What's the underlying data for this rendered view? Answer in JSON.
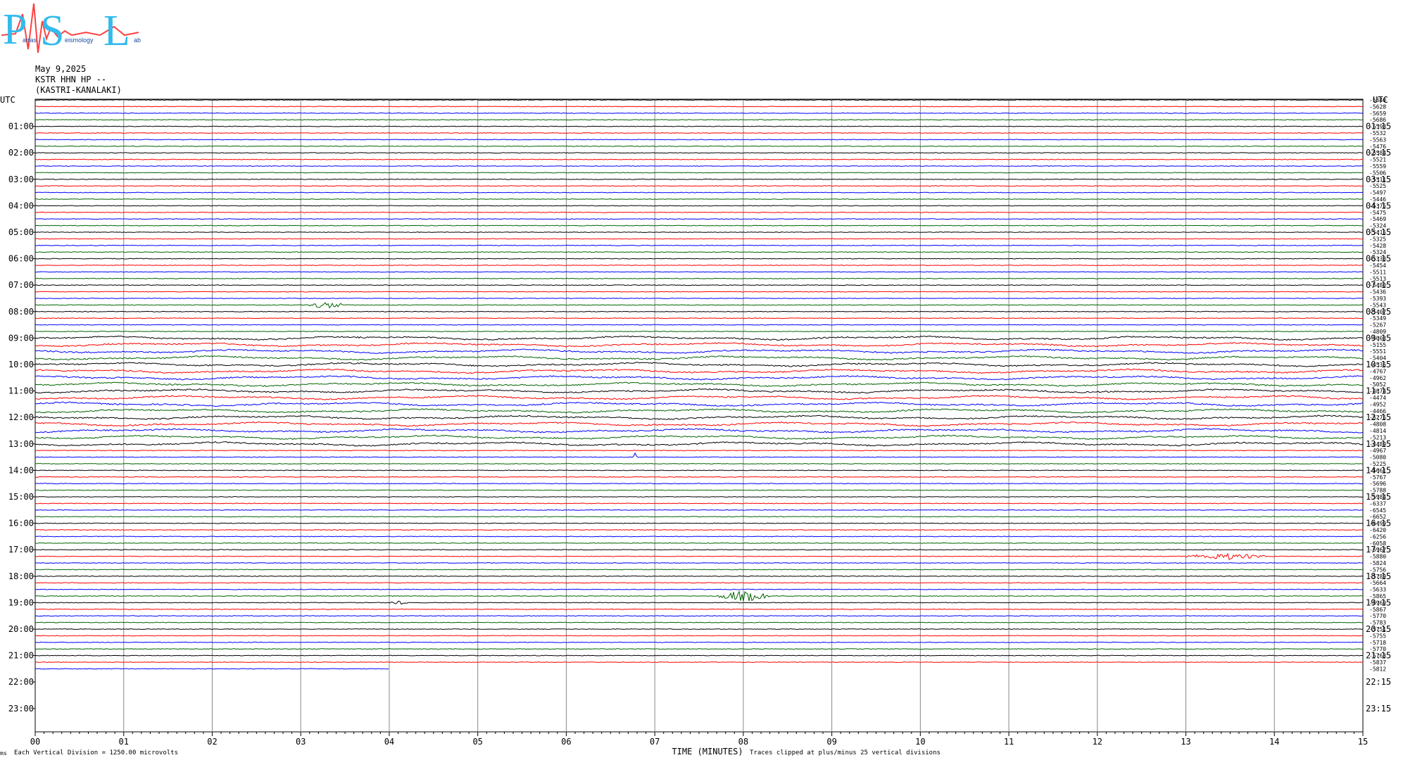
{
  "logo": {
    "big_letters": [
      "P",
      "S",
      "L"
    ],
    "small_text": [
      "atras",
      "eismology",
      "ab"
    ]
  },
  "header": {
    "date": "May 9,2025",
    "station": "KSTR HHN HP --",
    "site": "(KASTRI-KANALAKI)"
  },
  "chart_data": {
    "type": "line",
    "subtype": "helicorder",
    "xlabel": "TIME (MINUTES)",
    "x_ticks": [
      "00",
      "01",
      "02",
      "03",
      "04",
      "05",
      "06",
      "07",
      "08",
      "09",
      "10",
      "11",
      "12",
      "13",
      "14",
      "15"
    ],
    "xlim": [
      0,
      15
    ],
    "left_axis_title": "UTC",
    "right_axis_title": "UTC",
    "left_labels": [
      "01:00",
      "02:00",
      "03:00",
      "04:00",
      "05:00",
      "06:00",
      "07:00",
      "08:00",
      "09:00",
      "10:00",
      "11:00",
      "12:00",
      "13:00",
      "14:00",
      "15:00",
      "16:00",
      "17:00",
      "18:00",
      "19:00",
      "20:00",
      "21:00",
      "22:00",
      "23:00"
    ],
    "right_labels": [
      "01:15",
      "02:15",
      "03:15",
      "04:15",
      "05:15",
      "06:15",
      "07:15",
      "08:15",
      "09:15",
      "10:15",
      "11:15",
      "12:15",
      "13:15",
      "14:15",
      "15:15",
      "16:15",
      "17:15",
      "18:15",
      "19:15",
      "20:15",
      "21:15",
      "22:15",
      "23:15"
    ],
    "trace_colors": [
      "#000000",
      "#ff0000",
      "#0000ff",
      "#006400"
    ],
    "trace_count": 87,
    "last_trace_end_minute": 4.0,
    "offsets": [
      "-5640",
      "-5628",
      "-5659",
      "-5686",
      "-5598",
      "-5532",
      "-5563",
      "-5476",
      "-5584",
      "-5521",
      "-5559",
      "-5506",
      "-5511",
      "-5525",
      "-5497",
      "-5446",
      "-5375",
      "-5475",
      "-5469",
      "-5324",
      "-5415",
      "-5325",
      "-5428",
      "-5324",
      "-5330",
      "-5454",
      "-5511",
      "-5513",
      "-5480",
      "-5436",
      "-5393",
      "-5543",
      "-5407",
      "-5349",
      "-5267",
      "-4809",
      "-5008",
      "-5155",
      "-5551",
      "-5404",
      "-4536",
      "-4767",
      "-4962",
      "-5052",
      "-4874",
      "-4474",
      "-4952",
      "-4466",
      "-5275",
      "-4808",
      "-4814",
      "-5213",
      "-4489",
      "-4967",
      "-5080",
      "-5225",
      "-5661",
      "-5767",
      "-5696",
      "-5788",
      "-5984",
      "-6337",
      "-6545",
      "-6652",
      "-6499",
      "-6420",
      "-6256",
      "-6058",
      "-5967",
      "-5880",
      "-5824",
      "-5756",
      "-5789",
      "-5664",
      "-5633",
      "-5865",
      "-5969",
      "-5867",
      "-5770",
      "-5783",
      "-5751",
      "-5755",
      "-5718",
      "-5770",
      "-5763",
      "-5837",
      "-5812"
    ],
    "footer_left": "Each Vertical Division = 1250.00 microvolts",
    "footer_right": "Traces clipped at plus/minus 25 vertical divisions",
    "footer_mark": "ms",
    "events": [
      {
        "trace": 31,
        "minute_start": 3.1,
        "minute_end": 3.5,
        "amplitude": 3
      },
      {
        "trace": 54,
        "minute_start": 6.75,
        "minute_end": 6.8,
        "amplitude": 4
      },
      {
        "trace": 69,
        "minute_start": 13.0,
        "minute_end": 13.9,
        "amplitude": 3
      },
      {
        "trace": 75,
        "minute_start": 7.7,
        "minute_end": 8.3,
        "amplitude": 5
      },
      {
        "trace": 76,
        "minute_start": 4.0,
        "minute_end": 4.2,
        "amplitude": 2
      }
    ]
  }
}
